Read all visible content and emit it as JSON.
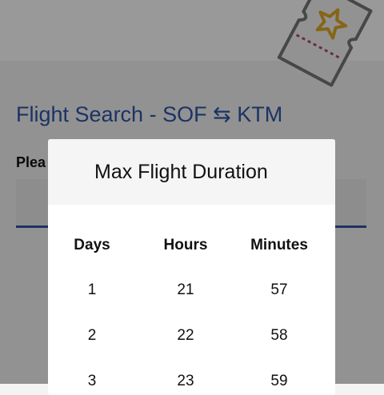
{
  "page": {
    "title": "Flight Search - SOF",
    "swap_glyph": "⇆",
    "title_dest": "KTM",
    "field_label": "Plea"
  },
  "modal": {
    "title": "Max Flight Duration",
    "columns": [
      "Days",
      "Hours",
      "Minutes"
    ],
    "rows": [
      [
        "1",
        "21",
        "57"
      ],
      [
        "2",
        "22",
        "58"
      ],
      [
        "3",
        "23",
        "59"
      ]
    ]
  },
  "colors": {
    "accent": "#2d56a8",
    "ticket_star": "#e0a928",
    "ticket_perforation": "#b54a6e"
  },
  "icons": [
    "ticket-icon",
    "swap-arrows-icon"
  ]
}
